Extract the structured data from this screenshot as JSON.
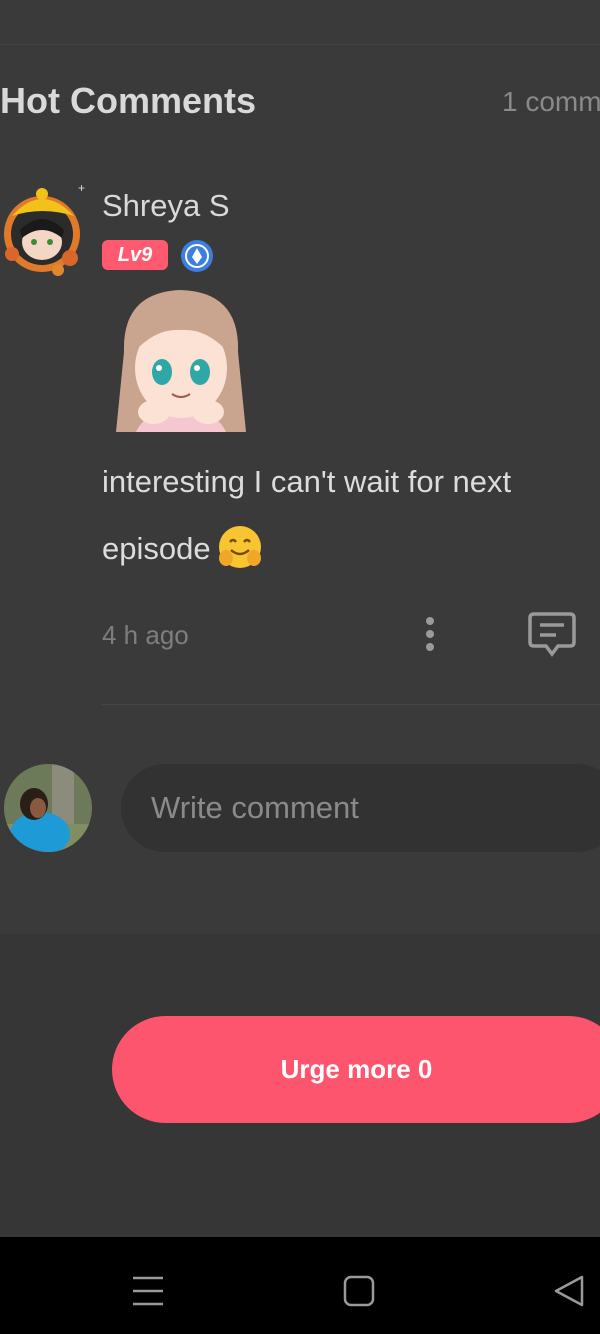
{
  "section": {
    "title": "Hot Comments",
    "count_label": "1 comm"
  },
  "comment": {
    "username": "Shreya S",
    "level_badge": "Lv9",
    "text_line1": "interesting    I can't wait for  next",
    "text_line2": "episode",
    "emoji": "hugging-face-emoji",
    "timestamp": "4 h ago"
  },
  "composer": {
    "placeholder": "Write comment"
  },
  "actions": {
    "urge_label": "Urge more 0"
  },
  "icons": {
    "more": "vertical-dots-icon",
    "reply": "message-bubble-icon",
    "verified": "verified-badge-icon",
    "nav_menu": "menu-lines-icon",
    "nav_home": "square-home-icon",
    "nav_back": "triangle-back-icon"
  },
  "colors": {
    "background": "#3a3a3a",
    "accent": "#fd556e",
    "level_badge": "#ff5a6f",
    "verified": "#3d7fe0",
    "navbar": "#000000"
  }
}
